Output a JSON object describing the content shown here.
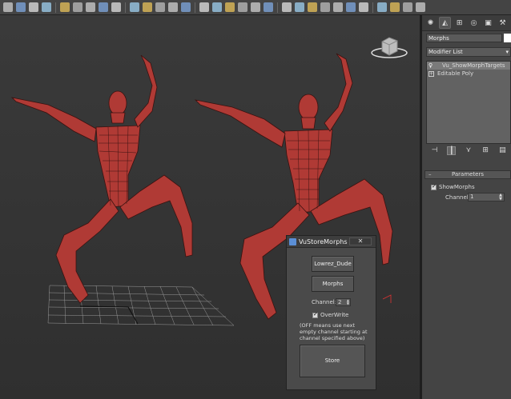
{
  "toolbar": {
    "icons": [
      "undo-icon",
      "redo-icon",
      "select-icon",
      "select-region-icon",
      "window-crossing-icon",
      "move-icon",
      "rotate-icon",
      "scale-icon",
      "reference-icon",
      "pivot-icon",
      "snap-icon",
      "angle-snap-icon",
      "percent-snap-icon",
      "spinner-snap-icon",
      "named-selection-icon",
      "mirror-icon",
      "align-icon",
      "layer-icon",
      "graph-icon",
      "material-icon",
      "render-setup-icon",
      "render-icon",
      "teapot-icon",
      "sphere-icon",
      "light-icon",
      "camera-icon",
      "helper-icon",
      "spacewarp-icon",
      "systems-icon",
      "xref-icon",
      "help-icon"
    ]
  },
  "panel": {
    "tabs": [
      "create-tab",
      "modify-tab",
      "hierarchy-tab",
      "motion-tab",
      "display-tab",
      "utilities-tab"
    ],
    "object_name": "Morphs",
    "modifier_list": "Modifier List",
    "stack": [
      "Vu_ShowMorphTargets",
      "Editable Poly"
    ],
    "rollout_title": "Parameters",
    "show_morphs_label": "ShowMorphs",
    "channel_label": "Channel",
    "channel_value": "1"
  },
  "dialog": {
    "title": "VuStoreMorphs",
    "close_label": "✕",
    "lowrez_button": "Lowrez_Dude",
    "morphs_button": "Morphs",
    "channel_label": "Channel:",
    "channel_value": "2",
    "overwrite_label": "OverWrite",
    "note": "(OFF means use next empty channel starting at channel specified above)",
    "store_button": "Store"
  },
  "colors": {
    "mesh": "#b03a35",
    "viewport_bg": "#333333",
    "panel_bg": "#444444"
  }
}
